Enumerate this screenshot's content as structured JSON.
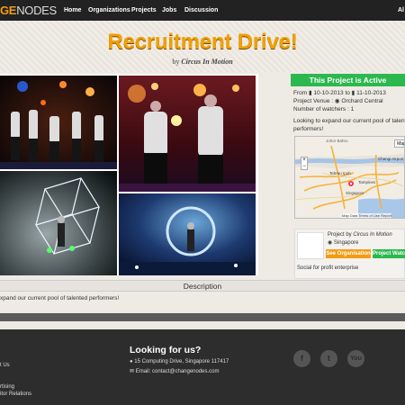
{
  "navbar": {
    "brand_left": "GE",
    "brand_right": "NODES",
    "links": [
      "Home",
      "Organizations",
      "Projects",
      "Jobs",
      "Discussion"
    ],
    "user_cut": "Al"
  },
  "hero": {
    "title": "Recruitment Drive!",
    "by_prefix": "by",
    "by_org": "Circus In Motion"
  },
  "project": {
    "status": "This Project is Active",
    "from_label": "From",
    "from_date": "10-10-2013",
    "to_label": "to",
    "to_date": "11-10-2013",
    "venue_label": "Project Venue :",
    "venue": "Orchard Central",
    "watchers_label": "Number of watchers :",
    "watchers": "1",
    "summary_line1": "Looking to expand our current pool of talented",
    "summary_line2": "performers!"
  },
  "map": {
    "map_button": "Map",
    "label_johor": "Johor Bahru",
    "label_changi": "Changi Airport Singapore",
    "label_singapore": "Singapore",
    "label_tampines": "Tampines",
    "label_ipoh": "Tebrau Ipoh",
    "data_credit": "Map Data",
    "terms": "Terms of Use",
    "report": "Report"
  },
  "org": {
    "project_by_prefix": "Project by",
    "org_name": "Circus In Motion",
    "country": "Singapore",
    "see_org_button": "See Organisation",
    "watch_button": "Project Watch",
    "type": "Social for profit enterprise"
  },
  "description": {
    "heading": "Description",
    "text": "xpand our current pool of talented performers!"
  },
  "footer": {
    "heading": "Looking for us?",
    "address": "15 Computing Drive, Singapore 117417",
    "email": "Email: contact@changenodes.com",
    "left_1": "t Us",
    "left_2": "rtising",
    "left_3": "itor Relations",
    "social": [
      "f",
      "t",
      "You"
    ]
  },
  "colors": {
    "accent": "#f0a000",
    "active_green": "#2cb84f",
    "see_org_orange": "#f39c12",
    "watch_green": "#2cb84f"
  }
}
